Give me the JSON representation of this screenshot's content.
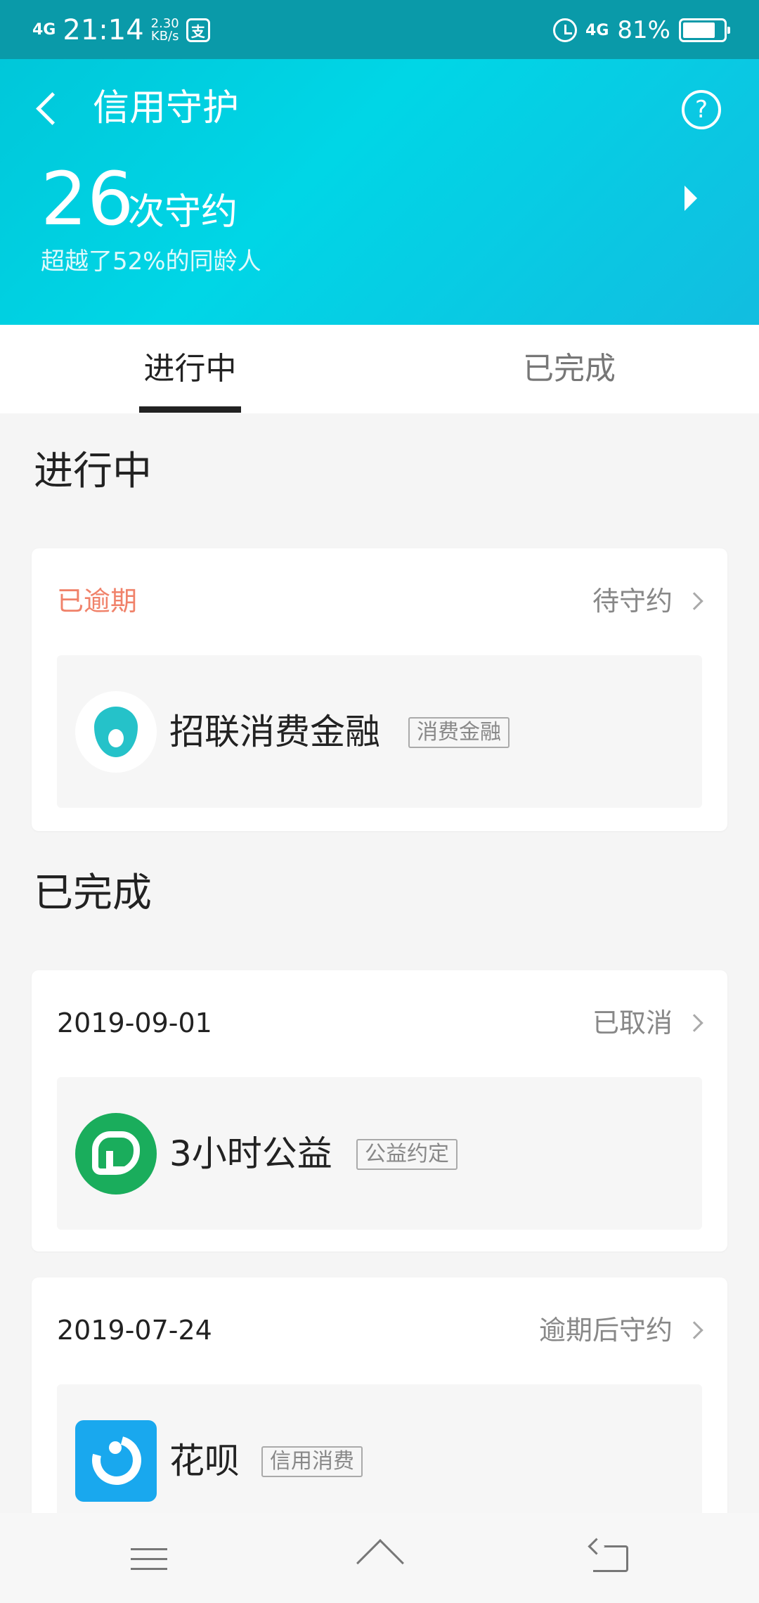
{
  "status_bar": {
    "signal": "4G",
    "time": "21:14",
    "speed_value": "2.30",
    "speed_unit": "KB/s",
    "app_badge": "支",
    "network_right": "4G",
    "battery_percent": "81%",
    "battery_level": 0.81
  },
  "nav": {
    "title": "信用守护",
    "help_symbol": "?"
  },
  "score": {
    "count": "26",
    "unit": "次守约",
    "subtitle": "超越了52%的同龄人"
  },
  "tabs": [
    {
      "label": "进行中",
      "active": true
    },
    {
      "label": "已完成",
      "active": false
    }
  ],
  "sections": {
    "in_progress_title": "进行中",
    "completed_title": "已完成"
  },
  "in_progress_cards": [
    {
      "status_left": "已逾期",
      "status_right": "待守约",
      "name": "招联消费金融",
      "tag": "消费金融",
      "logo_icon": "zhaolian-drop-icon"
    }
  ],
  "completed_cards": [
    {
      "date": "2019-09-01",
      "status_right": "已取消",
      "name": "3小时公益",
      "tag": "公益约定",
      "logo_icon": "charity-heart-icon"
    },
    {
      "date": "2019-07-24",
      "status_right": "逾期后守约",
      "name": "花呗",
      "tag": "信用消费",
      "logo_icon": "huabei-icon"
    }
  ],
  "colors": {
    "header_gradient_start": "#00c5d8",
    "header_gradient_end": "#12bde0",
    "overdue": "#f0826a",
    "charity_green": "#1aad5c",
    "huabei_blue": "#19a8ee"
  }
}
